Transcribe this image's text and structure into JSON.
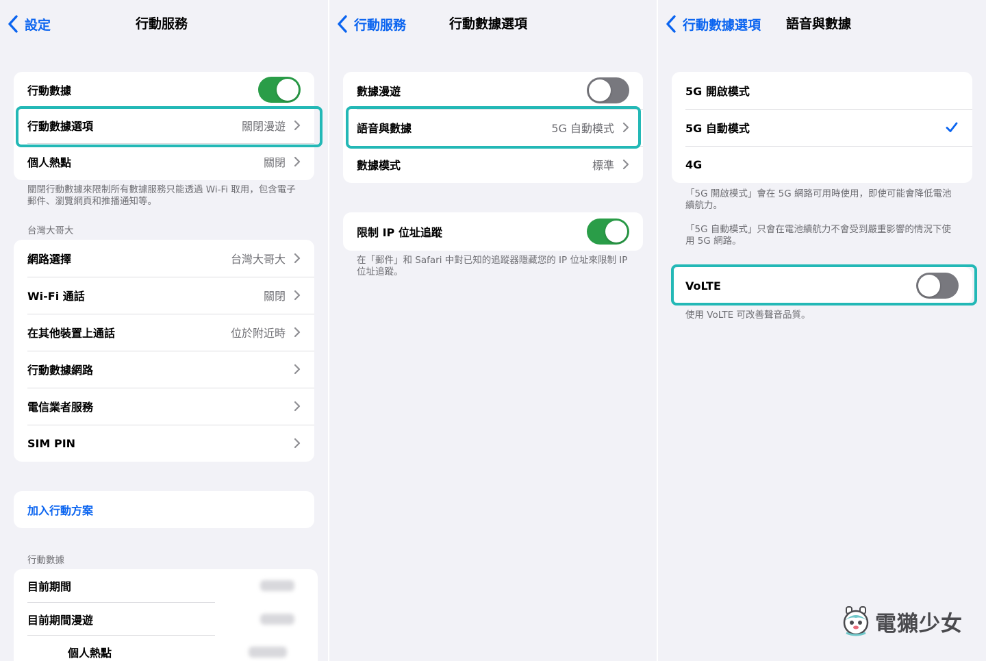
{
  "panel1": {
    "back_label": "設定",
    "title": "行動服務",
    "group1": [
      {
        "label": "行動數據",
        "toggle": "on"
      },
      {
        "label": "行動數據選項",
        "value": "關閉漫遊"
      },
      {
        "label": "個人熱點",
        "value": "關閉"
      }
    ],
    "note": "關閉行動數據來限制所有數據服務只能透過 Wi-Fi 取用，包含電子郵件、瀏覽網頁和推播通知等。",
    "carrier_header": "台灣大哥大",
    "carrier_group": [
      {
        "label": "網路選擇",
        "value": "台灣大哥大"
      },
      {
        "label": "Wi-Fi 通話",
        "value": "關閉"
      },
      {
        "label": "在其他裝置上通話",
        "value": "位於附近時"
      },
      {
        "label": "行動數據網路",
        "value": ""
      },
      {
        "label": "電信業者服務",
        "value": ""
      },
      {
        "label": "SIM PIN",
        "value": ""
      }
    ],
    "add_plan": "加入行動方案",
    "usage_header": "行動數據",
    "usage_rows": [
      "目前期間",
      "目前期間漫遊",
      "個人熱點"
    ]
  },
  "panel2": {
    "back_label": "行動服務",
    "title": "行動數據選項",
    "group1": [
      {
        "label": "數據漫遊",
        "toggle": "off"
      },
      {
        "label": "語音與數據",
        "value": "5G 自動模式"
      },
      {
        "label": "數據模式",
        "value": "標準"
      }
    ],
    "group2": [
      {
        "label": "限制 IP 位址追蹤",
        "toggle": "on"
      }
    ],
    "note": "在「郵件」和 Safari 中對已知的追蹤器隱藏您的 IP 位址來限制 IP 位址追蹤。"
  },
  "panel3": {
    "back_label": "行動數據選項",
    "title": "語音與數據",
    "options": [
      {
        "label": "5G 開啟模式",
        "checked": false
      },
      {
        "label": "5G 自動模式",
        "checked": true
      },
      {
        "label": "4G",
        "checked": false
      }
    ],
    "note1": "「5G 開啟模式」會在 5G 網路可用時使用，即使可能會降低電池續航力。",
    "note2": "「5G 自動模式」只會在電池續航力不會受到嚴重影響的情況下使用 5G 網路。",
    "volte_label": "VoLTE",
    "volte_toggle": "off",
    "volte_note": "使用 VoLTE 可改善聲音品質。"
  },
  "watermark": "電獺少女",
  "colors": {
    "accent": "#0a64f0",
    "toggle_on": "#2a9d48",
    "highlight": "#23b8b6",
    "background": "#f2f2f7"
  }
}
